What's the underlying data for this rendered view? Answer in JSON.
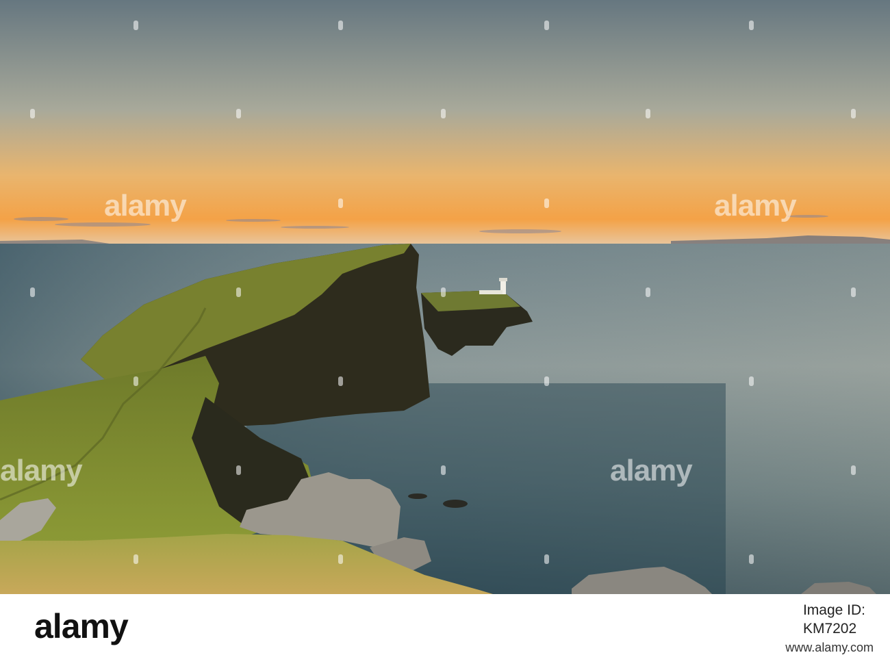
{
  "watermark": {
    "text": "alamy"
  },
  "footer": {
    "logo": "alamy",
    "image_id_label": "Image ID:",
    "image_id_value": "KM7202",
    "site_url": "www.alamy.com"
  },
  "scene": {
    "subject": "lighthouse",
    "colors": {
      "sky_top": "#6b7a80",
      "sky_horizon": "#f0a24a",
      "sea": "#31505c",
      "grass": "#7c8a2c",
      "cliff": "#2f2d1f"
    }
  }
}
